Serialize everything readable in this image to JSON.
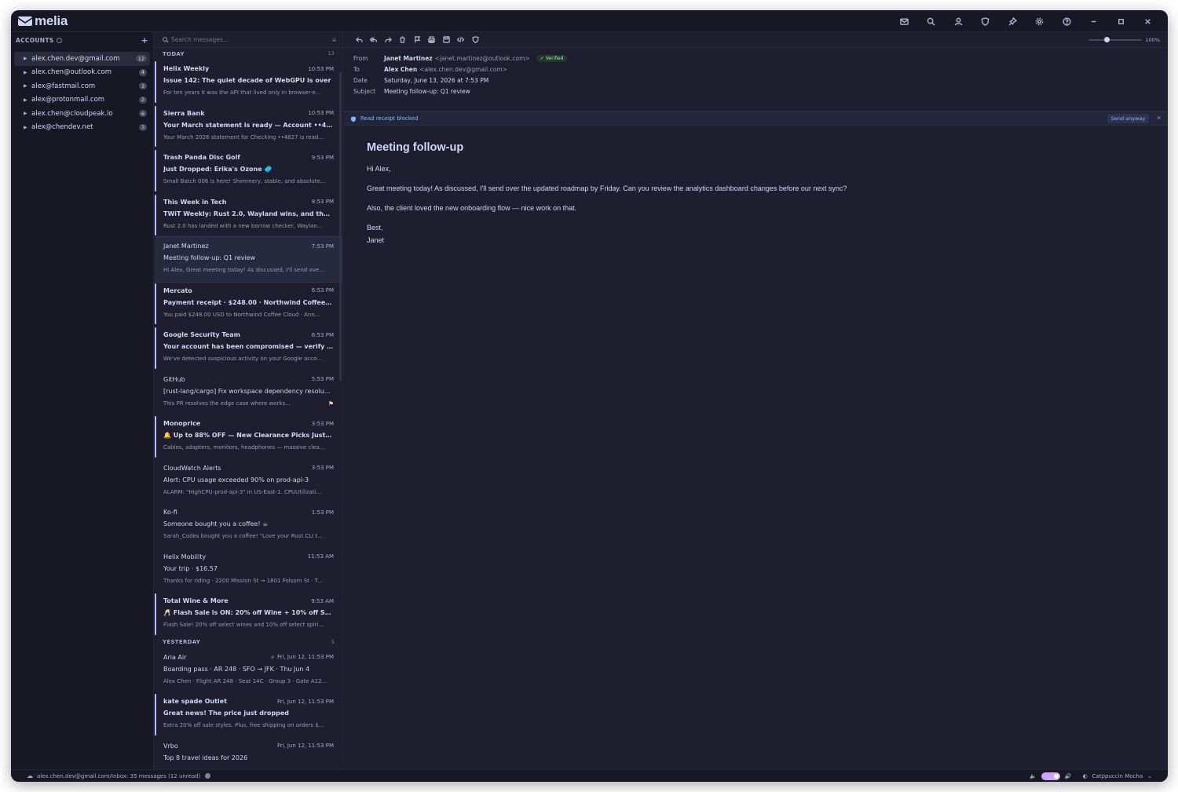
{
  "app": {
    "name": "melia"
  },
  "titlebar": {
    "icons": [
      "mail-icon",
      "search-icon",
      "user-icon",
      "shield-icon",
      "pin-icon",
      "gear-icon",
      "help-icon",
      "minimize-icon",
      "maximize-icon",
      "close-icon"
    ]
  },
  "sidebar": {
    "header": "ACCOUNTS",
    "add": "+",
    "accounts": [
      {
        "address": "alex.chen.dev@gmail.com",
        "count": "12"
      },
      {
        "address": "alex.chen@outlook.com",
        "count": "4"
      },
      {
        "address": "alex@fastmail.com",
        "count": "3"
      },
      {
        "address": "alex@protonmail.com",
        "count": "2"
      },
      {
        "address": "alex.chen@cloudpeak.io",
        "count": "6"
      },
      {
        "address": "alex@chendev.net",
        "count": "3"
      }
    ]
  },
  "list": {
    "search_placeholder": "Search messages...",
    "today": {
      "label": "TODAY",
      "count": "13"
    },
    "yesterday": {
      "label": "YESTERDAY",
      "count": "5"
    },
    "messages": [
      {
        "from": "Helix Weekly",
        "time": "10:53 PM",
        "subject": "Issue 142: The quiet decade of WebGPU is over",
        "preview": "For ten years it was the API that lived only in browser-e..."
      },
      {
        "from": "Sierra Bank",
        "time": "10:53 PM",
        "subject": "Your March statement is ready — Account ••4827",
        "preview": "Your March 2026 statement for Checking ••4827 is read..."
      },
      {
        "from": "Trash Panda Disc Golf",
        "time": "9:53 PM",
        "subject": "Just Dropped: Erika's Ozone 🥏",
        "preview": "Small Batch 006 is here! Shimmery, stable, and absolute..."
      },
      {
        "from": "This Week in Tech",
        "time": "8:53 PM",
        "subject": "TWiT Weekly: Rust 2.0, Wayland wins, and the de...",
        "preview": "Rust 2.0 has landed with a new borrow checker, Waylan..."
      },
      {
        "from": "Janet Martinez",
        "time": "7:53 PM",
        "subject": "Meeting follow-up: Q1 review",
        "preview": "Hi Alex, Great meeting today! As discussed, I'll send ove..."
      },
      {
        "from": "Mercato",
        "time": "6:53 PM",
        "subject": "Payment receipt · $248.00 · Northwind Coffee Clo...",
        "preview": "You paid $248.00 USD to Northwind Coffee Cloud · Ann..."
      },
      {
        "from": "Google Security Team",
        "time": "6:53 PM",
        "subject": "Your account has been compromised — verify im...",
        "preview": "We've detected suspicious activity on your Google acco..."
      },
      {
        "from": "GitHub",
        "time": "5:53 PM",
        "subject": "[rust-lang/cargo] Fix workspace dependency resolu...",
        "preview": "This PR resolves the edge case where works..."
      },
      {
        "from": "Monoprice",
        "time": "3:53 PM",
        "subject": "🔔 Up to 88% OFF — New Clearance Picks Just D...",
        "preview": "Cables, adapters, monitors, headphones — massive clea..."
      },
      {
        "from": "CloudWatch Alerts",
        "time": "3:53 PM",
        "subject": "Alert: CPU usage exceeded 90% on prod-api-3",
        "preview": "ALARM: \"HighCPU-prod-api-3\" in US-East-1. CPUUtilizati..."
      },
      {
        "from": "Ko-fi",
        "time": "1:53 PM",
        "subject": "Someone bought you a coffee! ☕",
        "preview": "Sarah_Codes bought you a coffee! \"Love your Rust CLI t..."
      },
      {
        "from": "Helix Mobility",
        "time": "11:53 AM",
        "subject": "Your trip · $16.57",
        "preview": "Thanks for riding · 2200 Mission St → 1801 Folsom St · T..."
      },
      {
        "from": "Total Wine & More",
        "time": "9:53 AM",
        "subject": "🥂 Flash Sale is ON: 20% off Wine + 10% off Spirits",
        "preview": "Flash Sale! 20% off select wines and 10% off select spiri..."
      },
      {
        "from": "Aria Air",
        "time": "Fri, Jun 12, 11:53 PM",
        "subject": "Boarding pass · AR 248 · SFO → JFK · Thu Jun 4",
        "preview": "Alex Chen · Flight AR 248 · Seat 14C · Group 3 · Gate A12..."
      },
      {
        "from": "kate spade Outlet",
        "time": "Fri, Jun 12, 11:53 PM",
        "subject": "Great news! The price just dropped",
        "preview": "Extra 20% off sale styles. Plus, free shipping on orders $..."
      },
      {
        "from": "Vrbo",
        "time": "Fri, Jun 12, 11:53 PM",
        "subject": "Top 8 travel ideas for 2026",
        "preview": ""
      }
    ]
  },
  "reader": {
    "zoom": "100%",
    "zoom_value": 100,
    "labels": {
      "from": "From",
      "to": "To",
      "date": "Date",
      "subject": "Subject"
    },
    "from_name": "Janet Martinez",
    "from_email": "<janet.martinez@outlook.com>",
    "verified": "Verified",
    "to_name": "Alex Chen",
    "to_email": "<alex.chen.dev@gmail.com>",
    "date": "Saturday, June 13, 2026 at 7:53 PM",
    "subject": "Meeting follow-up: Q1 review",
    "banner": {
      "text": "Read receipt blocked",
      "action": "Send anyway",
      "close": "✕"
    },
    "title": "Meeting follow-up",
    "body": [
      "Hi Alex,",
      "Great meeting today! As discussed, I'll send over the updated roadmap by Friday. Can you review the analytics dashboard changes before our next sync?",
      "Also, the client loved the new onboarding flow — nice work on that.",
      "Best,",
      "Janet"
    ]
  },
  "status": {
    "path": "alex.chen.dev@gmail.com/Inbox: 35 messages (12 unread)",
    "theme": "Catppuccin Mocha"
  },
  "colors": {
    "accent": "#b4befe",
    "background": "#1e1e2e",
    "verified": "#a6e3a1",
    "flag": "#f9e2af",
    "toggle": "#cba6f7"
  }
}
